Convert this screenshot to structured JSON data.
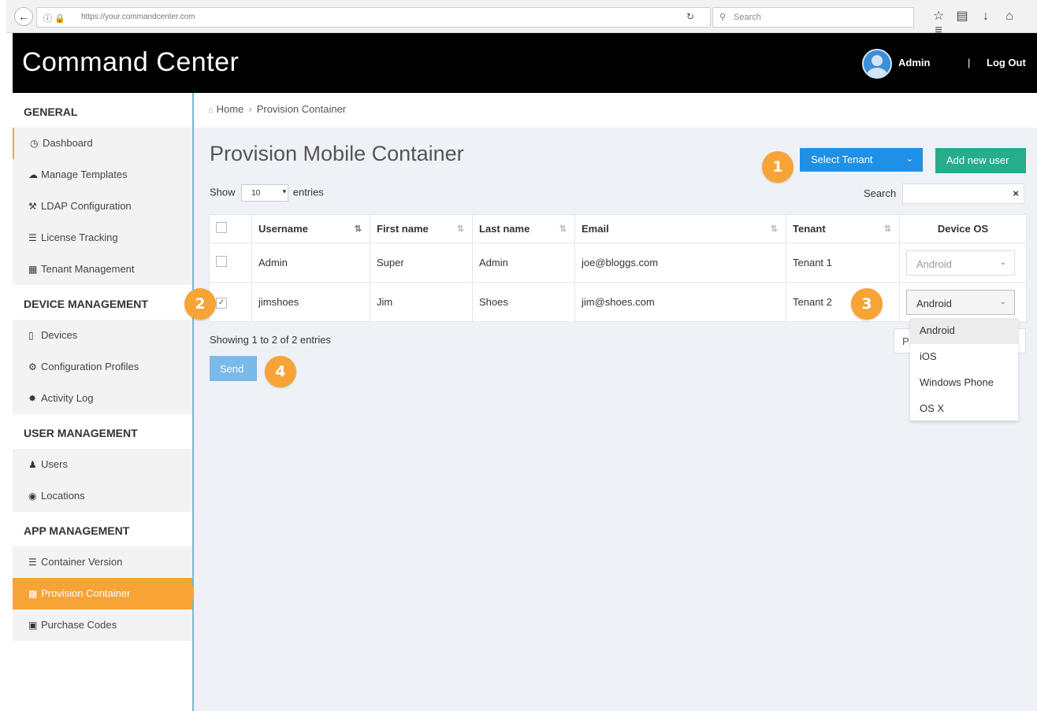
{
  "browser": {
    "url": "https://your.commandcenter.com",
    "search_placeholder": "Search"
  },
  "header": {
    "app_title": "Command Center",
    "user_name": "Admin",
    "separator": "|",
    "logout_label": "Log Out"
  },
  "sidebar": {
    "sections": [
      {
        "title": "GENERAL",
        "items": [
          {
            "label": "Dashboard",
            "icon": "dashboard-icon"
          },
          {
            "label": "Manage Templates",
            "icon": "cloud-icon"
          },
          {
            "label": "LDAP Configuration",
            "icon": "wrench-icon"
          },
          {
            "label": "License Tracking",
            "icon": "barcode-icon"
          },
          {
            "label": "Tenant Management",
            "icon": "building-icon"
          }
        ]
      },
      {
        "title": "DEVICE MANAGEMENT",
        "items": [
          {
            "label": "Devices",
            "icon": "phone-icon"
          },
          {
            "label": "Configuration Profiles",
            "icon": "cog-icon"
          },
          {
            "label": "Activity Log",
            "icon": "log-icon"
          }
        ]
      },
      {
        "title": "USER MANAGEMENT",
        "items": [
          {
            "label": "Users",
            "icon": "user-icon"
          },
          {
            "label": "Locations",
            "icon": "globe-icon"
          }
        ]
      },
      {
        "title": "APP MANAGEMENT",
        "items": [
          {
            "label": "Container Version",
            "icon": "list-icon"
          },
          {
            "label": "Provision Container",
            "icon": "qrcode-icon"
          },
          {
            "label": "Purchase Codes",
            "icon": "briefcase-icon"
          }
        ]
      }
    ]
  },
  "breadcrumb": {
    "home": "Home",
    "current": "Provision Container"
  },
  "page": {
    "title": "Provision Mobile Container",
    "select_tenant_label": "Select Tenant",
    "add_user_label": "Add new user",
    "show_label": "Show",
    "page_size": "10",
    "entries_label": "entries",
    "search_label": "Search",
    "showing_text": "Showing 1 to 2 of 2 entries",
    "send_label": "Send",
    "pager_stub": "P"
  },
  "table": {
    "columns": [
      "Username",
      "First name",
      "Last name",
      "Email",
      "Tenant",
      "Device OS"
    ],
    "rows": [
      {
        "checked": false,
        "username": "Admin",
        "first": "Super",
        "last": "Admin",
        "email": "joe@bloggs.com",
        "tenant": "Tenant 1",
        "os": "Android"
      },
      {
        "checked": true,
        "username": "jimshoes",
        "first": "Jim",
        "last": "Shoes",
        "email": "jim@shoes.com",
        "tenant": "Tenant 2",
        "os": "Android"
      }
    ]
  },
  "os_dropdown": {
    "options": [
      "Android",
      "iOS",
      "Windows Phone",
      "OS X"
    ],
    "selected": "Android"
  },
  "callouts": [
    "1",
    "2",
    "3",
    "4"
  ],
  "colors": {
    "accent_orange": "#f7a336",
    "primary_blue": "#1e90e6",
    "add_green": "#26ad8c",
    "send_blue": "#7bb9e8",
    "sidebar_border": "#5fc4cc"
  }
}
